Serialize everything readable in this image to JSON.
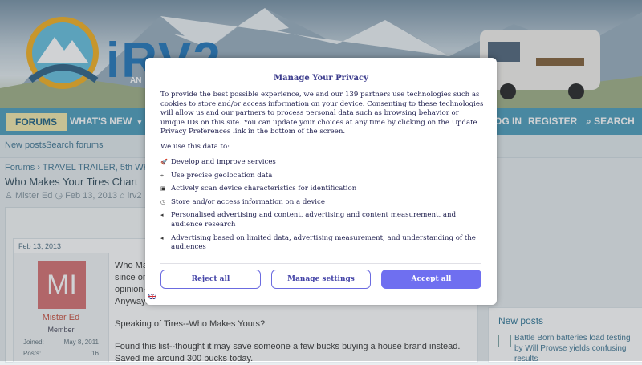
{
  "header": {
    "logo_text": "iRV2",
    "logo_sub": "AN"
  },
  "nav": {
    "forums": "FORUMS",
    "whats_new": "WHAT'S NEW",
    "login": "OG IN",
    "register": "REGISTER",
    "search": "SEARCH"
  },
  "subnav": {
    "new_posts": "New posts",
    "search_forums": "Search forums"
  },
  "breadcrumb": {
    "forums": "Forums",
    "section": "TRAVEL TRAILER, 5th WHEEL &"
  },
  "thread": {
    "title": "Who Makes Your Tires Chart",
    "author": "Mister Ed",
    "date": "Feb 13, 2013",
    "tag": "irv2",
    "tag2": "t"
  },
  "post": {
    "date": "Feb 13, 2013",
    "avatar_initials": "MI",
    "username": "Mister Ed",
    "role": "Member",
    "joined_label": "Joined:",
    "joined_value": "May 8, 2011",
    "posts_label": "Posts:",
    "posts_value": "16",
    "body_line1": "Who Ma",
    "body_line2": "since on",
    "body_line3": "opinion--",
    "body_line4": "Anyways",
    "body_p2": "Speaking of Tires--Who Makes Yours?",
    "body_p3": "Found this list--thought it may save someone a few bucks buying a house brand instead. Saved me around 300 bucks today."
  },
  "sidebar": {
    "title": "New posts",
    "link": "Battle Born batteries load testing by Will Prowse yields confusing results"
  },
  "modal": {
    "title": "Manage Your Privacy",
    "intro": "To provide the best possible experience, we and our 139 partners use technologies such as cookies to store and/or access information on your device. Consenting to these technologies will allow us and our partners to process personal data such as browsing behavior or unique IDs on this site. You can update your choices at any time by clicking on the Update Privacy Preferences link in the bottom of the screen.",
    "use_heading": "We use this data to:",
    "items": [
      "Develop and improve services",
      "Use precise geolocation data",
      "Actively scan device characteristics for identification",
      "Store and/or access information on a device",
      "Personalised advertising and content, advertising and content measurement, and audience research",
      "Advertising based on limited data, advertising measurement, and understanding of the audiences"
    ],
    "reject_label": "Reject all",
    "manage_label": "Manage settings",
    "accept_label": "Accept all"
  },
  "colors": {
    "nav": "#57a3c0",
    "accent": "#6f6ff0"
  }
}
